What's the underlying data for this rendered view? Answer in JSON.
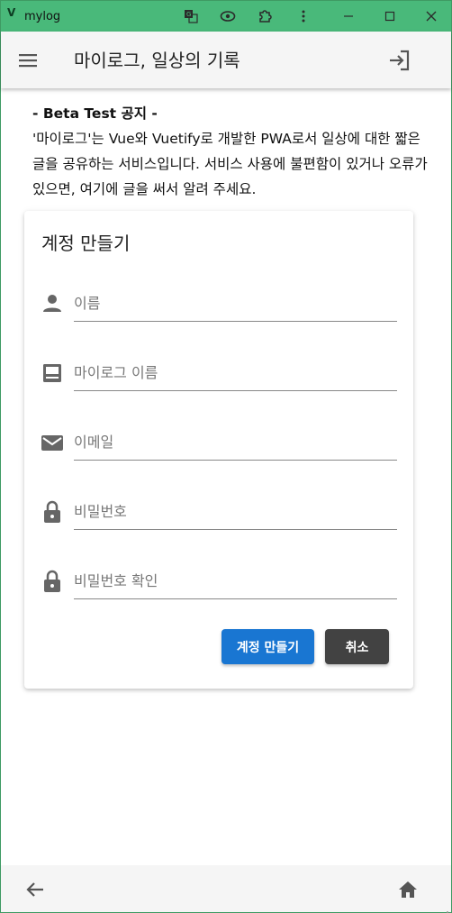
{
  "window": {
    "title": "mylog",
    "logo_glyph": "V",
    "icons": [
      "translate-icon",
      "eye-icon",
      "extension-icon",
      "more-vert-icon",
      "minimize-icon",
      "maximize-icon",
      "close-icon"
    ]
  },
  "appbar": {
    "title": "마이로그, 일상의 기록",
    "icons": [
      "menu-icon",
      "login-icon"
    ]
  },
  "notice": {
    "title": "- Beta Test 공지 -",
    "body": "'마이로그'는 Vue와 Vuetify로 개발한 PWA로서 일상에 대한 짧은 글을 공유하는 서비스입니다. 서비스 사용에 불편함이 있거나 오류가 있으면, 여기에 글을 써서 알려 주세요."
  },
  "card": {
    "title": "계정 만들기",
    "fields": [
      {
        "icon": "person-icon",
        "placeholder": "이름",
        "value": ""
      },
      {
        "icon": "book-icon",
        "placeholder": "마이로그 이름",
        "value": ""
      },
      {
        "icon": "email-icon",
        "placeholder": "이메일",
        "value": ""
      },
      {
        "icon": "lock-icon",
        "placeholder": "비밀번호",
        "value": ""
      },
      {
        "icon": "lock-icon",
        "placeholder": "비밀번호 확인",
        "value": ""
      }
    ],
    "create_label": "계정 만들기",
    "cancel_label": "취소"
  },
  "bottom": {
    "icons": [
      "arrow-left-icon",
      "home-icon"
    ]
  },
  "colors": {
    "titlebar": "#49b97a",
    "primary": "#1976d2",
    "cancel": "#424242",
    "icon": "#666666"
  }
}
